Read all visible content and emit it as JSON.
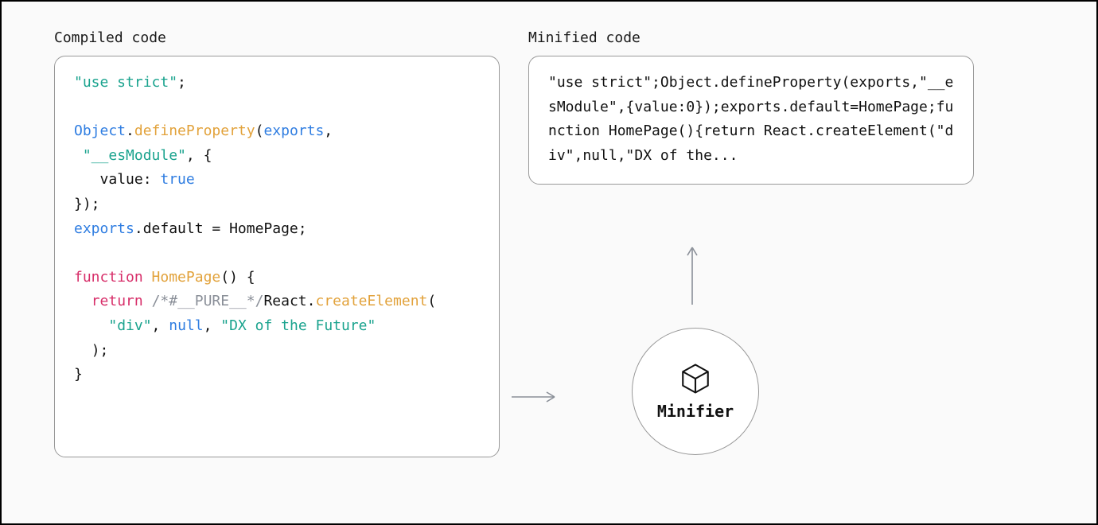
{
  "left": {
    "label": "Compiled code",
    "tokens": [
      {
        "c": "tok-str",
        "t": "\"use strict\""
      },
      {
        "c": "tok-plain",
        "t": ";\n\n"
      },
      {
        "c": "tok-class",
        "t": "Object"
      },
      {
        "c": "tok-plain",
        "t": "."
      },
      {
        "c": "tok-func",
        "t": "defineProperty"
      },
      {
        "c": "tok-plain",
        "t": "("
      },
      {
        "c": "tok-var",
        "t": "exports"
      },
      {
        "c": "tok-plain",
        "t": ",\n "
      },
      {
        "c": "tok-str",
        "t": "\"__esModule\""
      },
      {
        "c": "tok-plain",
        "t": ", {\n   value: "
      },
      {
        "c": "tok-bool",
        "t": "true"
      },
      {
        "c": "tok-plain",
        "t": "\n});\n"
      },
      {
        "c": "tok-var",
        "t": "exports"
      },
      {
        "c": "tok-plain",
        "t": ".default = HomePage;\n\n"
      },
      {
        "c": "tok-kw",
        "t": "function"
      },
      {
        "c": "tok-plain",
        "t": " "
      },
      {
        "c": "tok-func",
        "t": "HomePage"
      },
      {
        "c": "tok-plain",
        "t": "() {\n  "
      },
      {
        "c": "tok-kw",
        "t": "return"
      },
      {
        "c": "tok-plain",
        "t": " "
      },
      {
        "c": "tok-comment",
        "t": "/*#__PURE__*/"
      },
      {
        "c": "tok-plain",
        "t": "React."
      },
      {
        "c": "tok-func",
        "t": "createElement"
      },
      {
        "c": "tok-plain",
        "t": "(\n    "
      },
      {
        "c": "tok-str",
        "t": "\"div\""
      },
      {
        "c": "tok-plain",
        "t": ", "
      },
      {
        "c": "tok-bool",
        "t": "null"
      },
      {
        "c": "tok-plain",
        "t": ", "
      },
      {
        "c": "tok-str",
        "t": "\"DX of the Future\""
      },
      {
        "c": "tok-plain",
        "t": "\n  );\n}"
      }
    ]
  },
  "right": {
    "label": "Minified code",
    "text": "\"use strict\";Object.defineProperty(exports,\"__esModule\",{value:0});exports.default=HomePage;function HomePage(){return React.createElement(\"div\",null,\"DX of the..."
  },
  "node": {
    "label": "Minifier"
  }
}
